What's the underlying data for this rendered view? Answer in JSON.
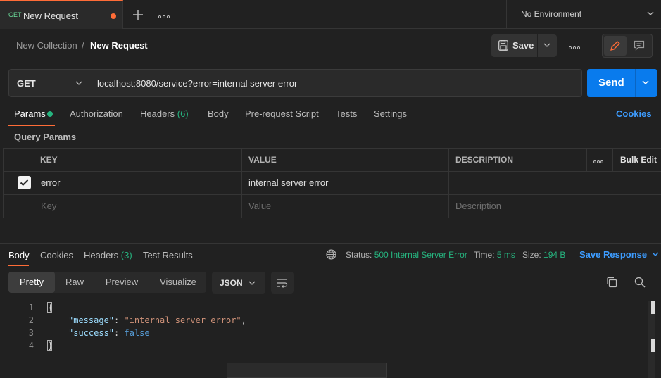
{
  "tab": {
    "method": "GET",
    "name": "New Request"
  },
  "environment": {
    "label": "No Environment"
  },
  "breadcrumb": {
    "collection": "New Collection",
    "separator": "/",
    "request": "New Request"
  },
  "toolbar": {
    "save_label": "Save"
  },
  "request": {
    "method": "GET",
    "url": "localhost:8080/service?error=internal server error",
    "send_label": "Send"
  },
  "request_tabs": {
    "params": "Params",
    "authorization": "Authorization",
    "headers": "Headers",
    "headers_count": "(6)",
    "body": "Body",
    "prerequest": "Pre-request Script",
    "tests": "Tests",
    "settings": "Settings",
    "cookies": "Cookies"
  },
  "query_params": {
    "title": "Query Params",
    "columns": {
      "key": "KEY",
      "value": "VALUE",
      "description": "DESCRIPTION",
      "bulk_edit": "Bulk Edit"
    },
    "rows": [
      {
        "key": "error",
        "value": "internal server error",
        "description": "",
        "enabled": true
      }
    ],
    "placeholders": {
      "key": "Key",
      "value": "Value",
      "description": "Description"
    }
  },
  "response_tabs": {
    "body": "Body",
    "cookies": "Cookies",
    "headers": "Headers",
    "headers_count": "(3)",
    "test_results": "Test Results"
  },
  "response_meta": {
    "status_label": "Status:",
    "status_value": "500 Internal Server Error",
    "time_label": "Time:",
    "time_value": "5 ms",
    "size_label": "Size:",
    "size_value": "194 B",
    "save_response": "Save Response"
  },
  "view_tabs": {
    "pretty": "Pretty",
    "raw": "Raw",
    "preview": "Preview",
    "visualize": "Visualize",
    "format": "JSON"
  },
  "code": {
    "line_numbers": [
      "1",
      "2",
      "3",
      "4"
    ],
    "open_brace": "{",
    "close_brace": "}",
    "line2_key": "\"message\"",
    "line2_value": "\"internal server error\"",
    "line3_key": "\"success\"",
    "line3_value": "false"
  },
  "colors": {
    "accent": "#ff6c37",
    "primary": "#097bed",
    "link": "#3d9cff",
    "success": "#26b47f",
    "background": "#212121"
  }
}
